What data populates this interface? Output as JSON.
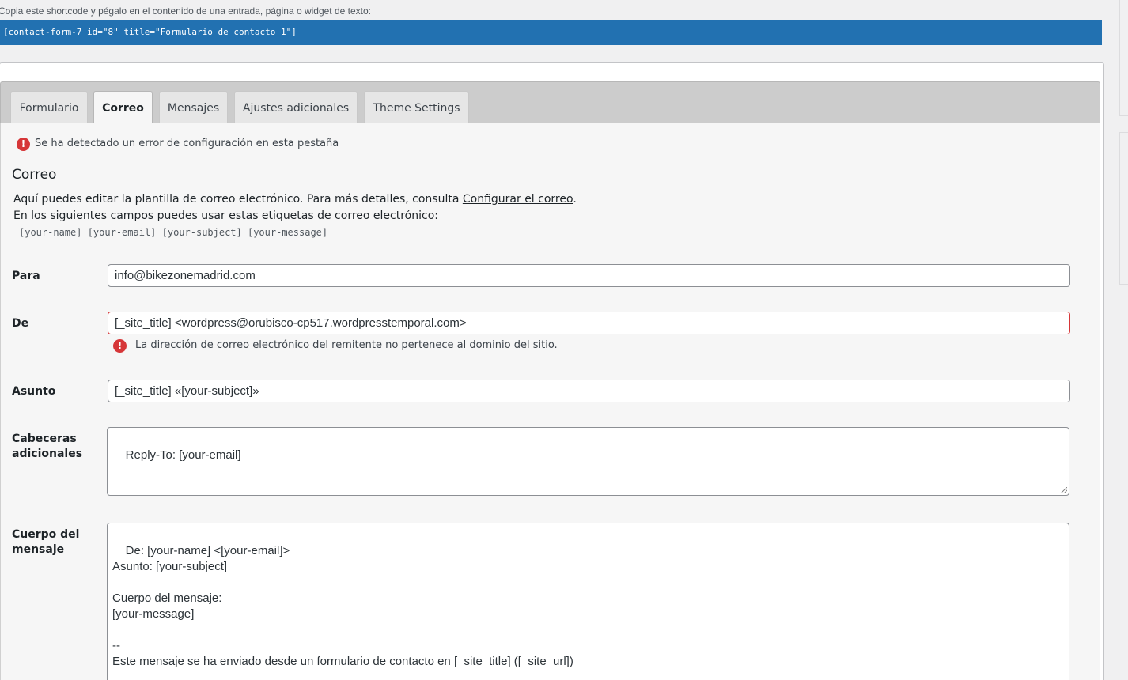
{
  "shortcode": {
    "hint": "Copia este shortcode y pégalo en el contenido de una entrada, página o widget de texto:",
    "value": "[contact-form-7 id=\"8\" title=\"Formulario de contacto 1\"]"
  },
  "tabs": [
    {
      "label": "Formulario"
    },
    {
      "label": "Correo"
    },
    {
      "label": "Mensajes"
    },
    {
      "label": "Ajustes adicionales"
    },
    {
      "label": "Theme Settings"
    }
  ],
  "panel": {
    "config_error": "Se ha detectado un error de configuración en esta pestaña",
    "error_icon": "!",
    "title": "Correo",
    "desc_line1_prefix": "Aquí puedes editar la plantilla de correo electrónico. Para más detalles, consulta ",
    "desc_link": "Configurar el correo",
    "desc_line1_suffix": ".",
    "desc_line2": "En los siguientes campos puedes usar estas etiquetas de correo electrónico:",
    "mail_tags": "[your-name] [your-email] [your-subject] [your-message]"
  },
  "fields": {
    "para": {
      "label": "Para",
      "value": "info@bikezonemadrid.com"
    },
    "de": {
      "label": "De",
      "value": "[_site_title] <wordpress@orubisco-cp517.wordpresstemporal.com>",
      "error": "La dirección de correo electrónico del remitente no pertenece al dominio del sitio."
    },
    "asunto": {
      "label": "Asunto",
      "value": "[_site_title] «[your-subject]»"
    },
    "cabeceras": {
      "label_line1": "Cabeceras",
      "label_line2": "adicionales",
      "value": "Reply-To: [your-email]"
    },
    "cuerpo": {
      "label_line1": "Cuerpo del",
      "label_line2": "mensaje",
      "value": "De: [your-name] <[your-email]>\nAsunto: [your-subject]\n\nCuerpo del mensaje:\n[your-message]\n\n-- \nEste mensaje se ha enviado desde un formulario de contacto en [_site_title] ([_site_url])"
    }
  },
  "colors": {
    "accent": "#2271b1",
    "error": "#d63638"
  }
}
